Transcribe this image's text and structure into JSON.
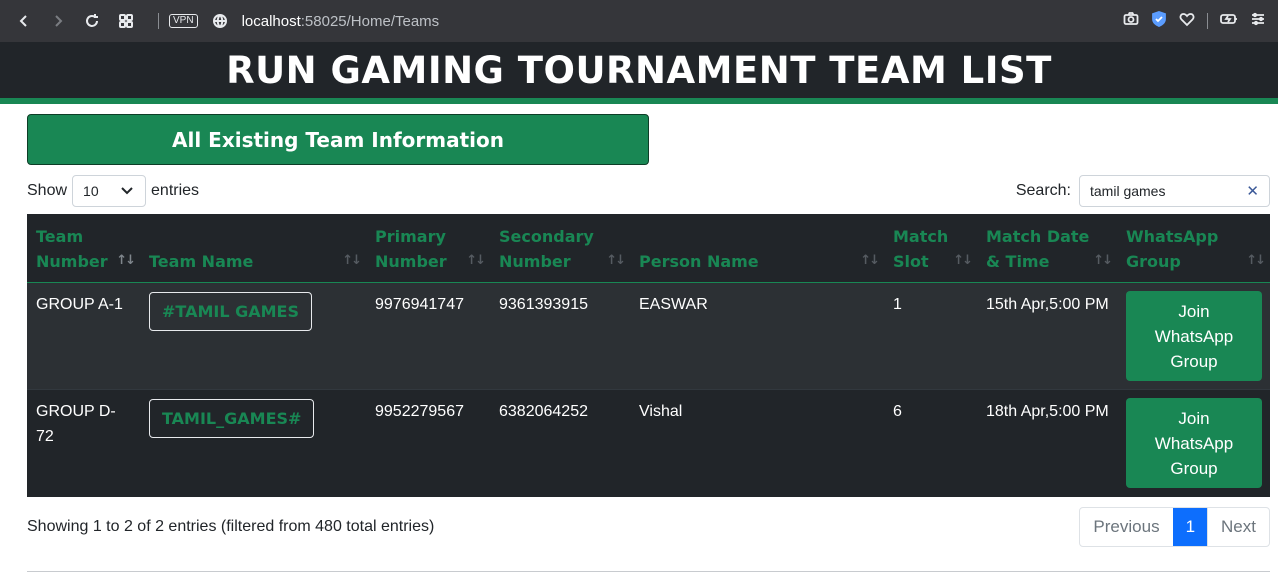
{
  "browser": {
    "vpn_label": "VPN",
    "url_host": "localhost",
    "url_path": ":58025/Home/Teams"
  },
  "header": {
    "title": "RUN GAMING TOURNAMENT TEAM LIST"
  },
  "banner": {
    "label": "All Existing Team Information"
  },
  "controls": {
    "show_label": "Show",
    "entries_value": "10",
    "entries_label": "entries",
    "search_label": "Search:",
    "search_value": "tamil games"
  },
  "table": {
    "headers": [
      {
        "line1": "Team",
        "line2": "Number"
      },
      {
        "line1": "",
        "line2": "Team Name"
      },
      {
        "line1": "Primary",
        "line2": "Number"
      },
      {
        "line1": "Secondary",
        "line2": "Number"
      },
      {
        "line1": "",
        "line2": "Person Name"
      },
      {
        "line1": "Match",
        "line2": "Slot"
      },
      {
        "line1": "Match Date",
        "line2": "& Time"
      },
      {
        "line1": "WhatsApp",
        "line2": "Group"
      }
    ],
    "sort_icon": "↑↓",
    "rows": [
      {
        "team_number": "GROUP A-1",
        "team_name": "#TAMIL GAMES",
        "primary": "9976941747",
        "secondary": "9361393915",
        "person": "EASWAR",
        "slot": "1",
        "datetime": "15th Apr,5:00 PM",
        "whatsapp": "Join WhatsApp Group"
      },
      {
        "team_number": "GROUP D-72",
        "team_name": "TAMIL_GAMES#",
        "primary": "9952279567",
        "secondary": "6382064252",
        "person": "Vishal",
        "slot": "6",
        "datetime": "18th Apr,5:00 PM",
        "whatsapp": "Join WhatsApp Group"
      }
    ]
  },
  "footer": {
    "info": "Showing 1 to 2 of 2 entries (filtered from 480 total entries)",
    "previous": "Previous",
    "page": "1",
    "next": "Next"
  },
  "colors": {
    "accent": "#198754",
    "dark": "#212529",
    "page_active": "#0d6efd"
  }
}
